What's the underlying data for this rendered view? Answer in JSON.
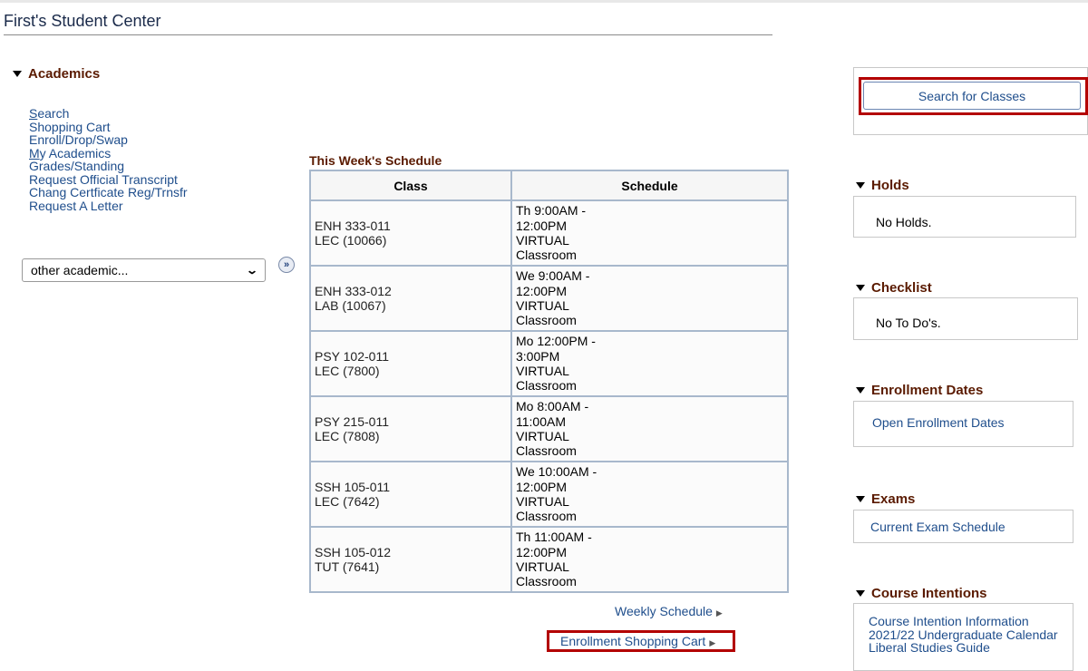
{
  "page": {
    "title": "First's Student Center"
  },
  "academics": {
    "header": "Academics",
    "links": [
      {
        "label": "Search",
        "underline_first": true
      },
      {
        "label": "Shopping Cart",
        "underline_first": false
      },
      {
        "label": "Enroll/Drop/Swap",
        "underline_first": false
      },
      {
        "label": "My Academics",
        "underline_first": true
      },
      {
        "label": "Grades/Standing",
        "underline_first": false
      },
      {
        "label": "Request Official Transcript",
        "underline_first": false
      },
      {
        "label": "Chang Certficate Reg/Trnsfr",
        "underline_first": false
      },
      {
        "label": "Request A Letter",
        "underline_first": false
      }
    ],
    "dropdown": {
      "selected": "other academic..."
    },
    "go_icon": "»"
  },
  "schedule": {
    "title": "This Week's Schedule",
    "columns": [
      "Class",
      "Schedule"
    ],
    "rows": [
      {
        "class_line1": "ENH 333-011",
        "class_line2": "LEC (10066)",
        "sched_line1": "Th 9:00AM -",
        "sched_line2": "12:00PM",
        "sched_line3": "VIRTUAL",
        "sched_line4": "Classroom"
      },
      {
        "class_line1": "ENH 333-012",
        "class_line2": "LAB (10067)",
        "sched_line1": "We 9:00AM -",
        "sched_line2": "12:00PM",
        "sched_line3": "VIRTUAL",
        "sched_line4": "Classroom"
      },
      {
        "class_line1": "PSY 102-011",
        "class_line2": "LEC (7800)",
        "sched_line1": "Mo 12:00PM -",
        "sched_line2": "3:00PM",
        "sched_line3": "VIRTUAL",
        "sched_line4": "Classroom"
      },
      {
        "class_line1": "PSY 215-011",
        "class_line2": "LEC (7808)",
        "sched_line1": "Mo 8:00AM -",
        "sched_line2": "11:00AM",
        "sched_line3": "VIRTUAL",
        "sched_line4": "Classroom"
      },
      {
        "class_line1": "SSH 105-011",
        "class_line2": "LEC (7642)",
        "sched_line1": "We 10:00AM -",
        "sched_line2": "12:00PM",
        "sched_line3": "VIRTUAL",
        "sched_line4": "Classroom"
      },
      {
        "class_line1": "SSH 105-012",
        "class_line2": "TUT (7641)",
        "sched_line1": "Th 11:00AM -",
        "sched_line2": "12:00PM",
        "sched_line3": "VIRTUAL",
        "sched_line4": "Classroom"
      }
    ],
    "weekly_link": "Weekly Schedule",
    "cart_link": "Enrollment Shopping Cart",
    "arrow_icon": "▶"
  },
  "right": {
    "search_button": "Search for Classes",
    "holds": {
      "header": "Holds",
      "text": "No Holds."
    },
    "checklist": {
      "header": "Checklist",
      "text": "No To Do's."
    },
    "enrollment_dates": {
      "header": "Enrollment Dates",
      "link": "Open Enrollment Dates"
    },
    "exams": {
      "header": "Exams",
      "link": "Current Exam Schedule"
    },
    "course_intentions": {
      "header": "Course Intentions",
      "links": [
        "Course Intention Information",
        "2021/22 Undergraduate Calendar",
        "Liberal Studies Guide"
      ]
    }
  },
  "colors": {
    "highlight": "#b30000",
    "link": "#1f4e8c",
    "header": "#5a1a00"
  }
}
